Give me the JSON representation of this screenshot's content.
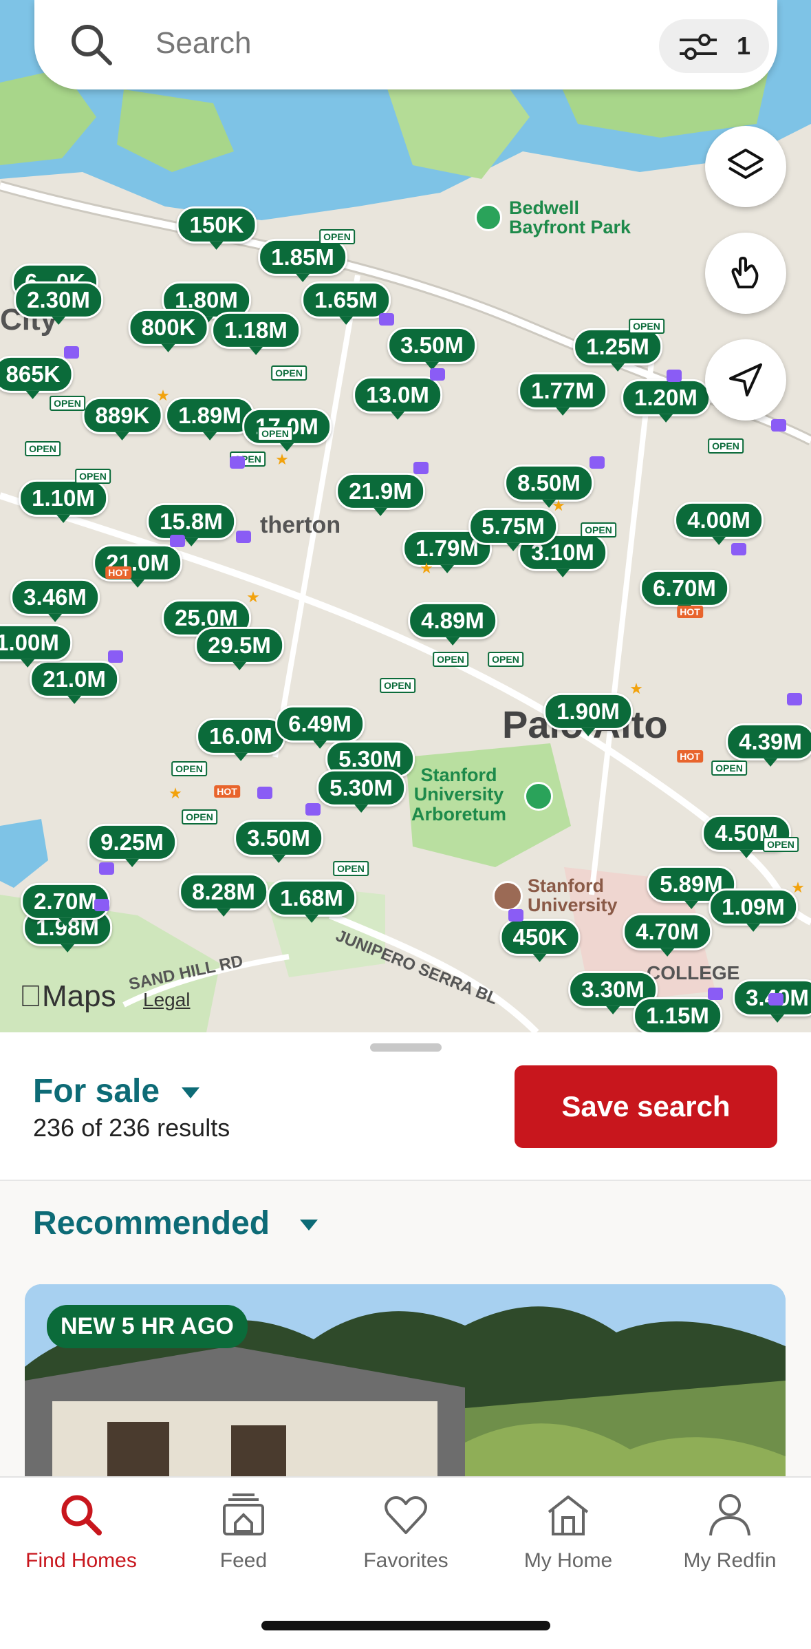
{
  "search": {
    "placeholder": "Search",
    "filter_count": "1"
  },
  "map": {
    "park_label": "Bedwell\nBayfront Park",
    "arboretum_label": "Stanford\nUniversity\nArboretum",
    "stanford_label": "Stanford\nUniversity",
    "atherton_label": "therton",
    "city_label": "Palo Alto",
    "partial_city": "City",
    "college_label": "COLLEGE",
    "sand_hill": "SAND HILL RD",
    "junipero": "JUNIPERO SERRA BL",
    "maps_logo": "Maps",
    "legal": "Legal",
    "prices": [
      "150K",
      "1.85M",
      "6...0K",
      "2.30M",
      "1.80M",
      "1.65M",
      "800K",
      "1.18M",
      "3.50M",
      "865K",
      "889K",
      "1.89M",
      "17.0M",
      "13.0M",
      "1.25M",
      "1.20M",
      "1.77M",
      "1.10M",
      "21.9M",
      "8.50M",
      "15.8M",
      "1.79M",
      "3.10M",
      "5.75M",
      "4.00M",
      "6.70M",
      "3.46M",
      "25.0M",
      "29.5M",
      "21.0M",
      "1.00M",
      "16.0M",
      "6.49M",
      "5.30M",
      "5.30M",
      "1.90M",
      "4.89M",
      "9.25M",
      "3.50M",
      "8.28M",
      "1.68M",
      "1.98M",
      "5.89M",
      "4.70M",
      "4.50M",
      "450K",
      "3.30M",
      "1.15M",
      "1.09M",
      "3.40M",
      "4.39M",
      "21.0M",
      "2.70M"
    ]
  },
  "sheet": {
    "status": "For sale",
    "results": "236 of 236 results",
    "save_button": "Save search",
    "sort": "Recommended",
    "card_badge": "NEW 5 HR AGO"
  },
  "tabs": [
    {
      "label": "Find Homes",
      "icon": "search-icon",
      "active": true
    },
    {
      "label": "Feed",
      "icon": "feed-icon",
      "active": false
    },
    {
      "label": "Favorites",
      "icon": "heart-icon",
      "active": false
    },
    {
      "label": "My Home",
      "icon": "house-icon",
      "active": false
    },
    {
      "label": "My Redfin",
      "icon": "profile-icon",
      "active": false
    }
  ],
  "colors": {
    "brand_red": "#c8161d",
    "pin_green": "#0b6b3a",
    "teal_text": "#0d6b76"
  }
}
